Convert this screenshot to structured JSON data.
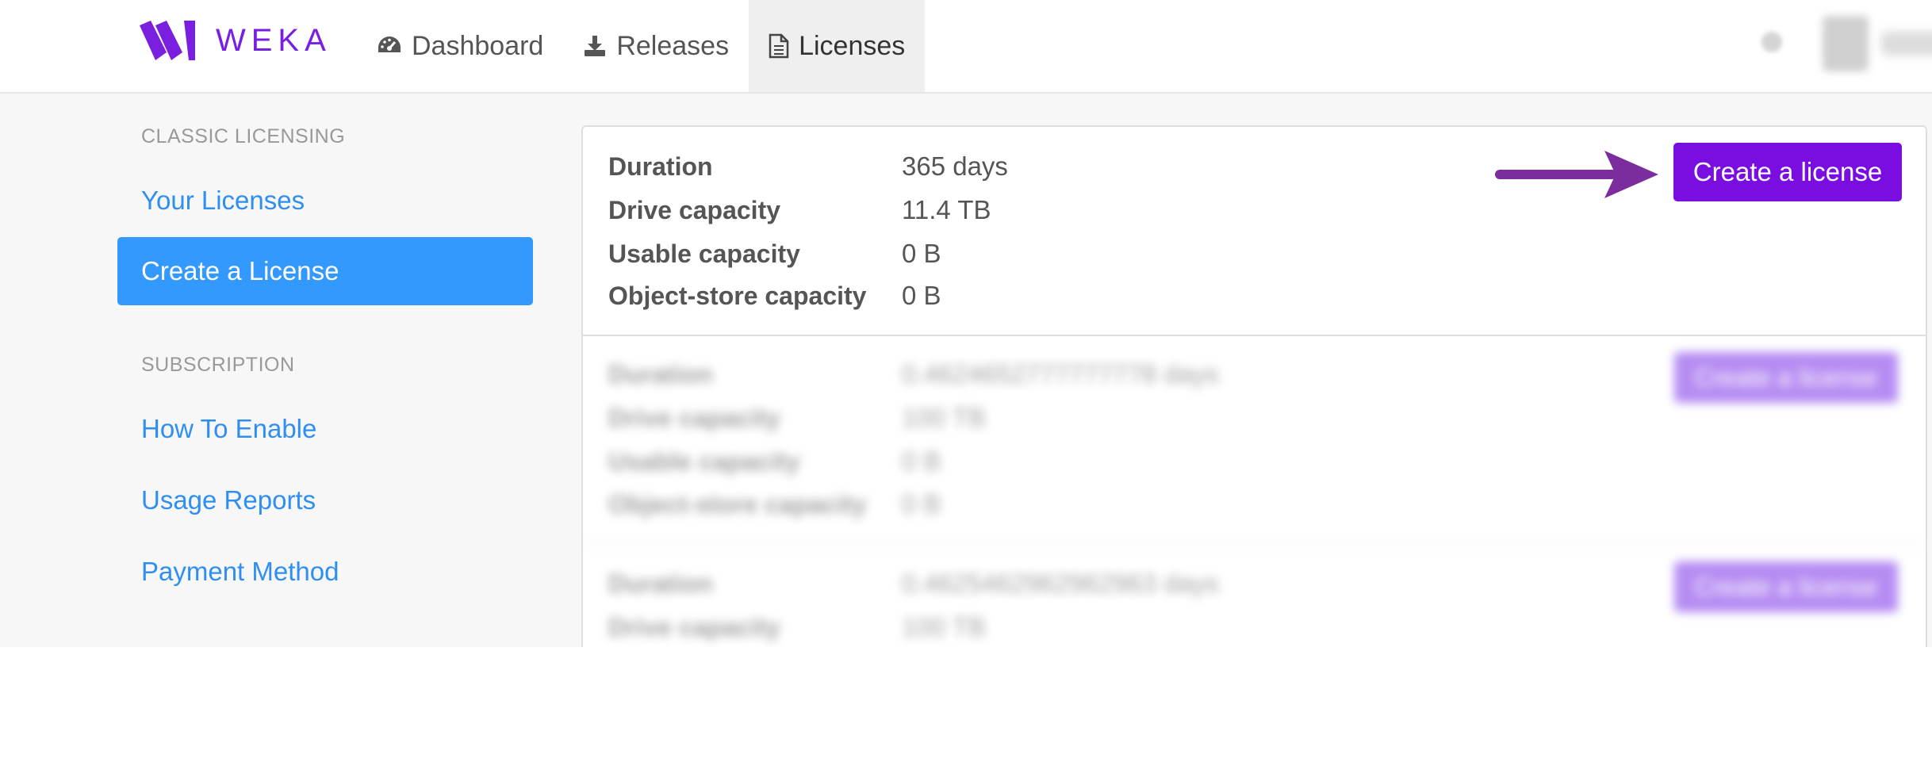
{
  "brand": {
    "name": "WEKA",
    "color": "#7a1fe0"
  },
  "nav": {
    "items": [
      {
        "label": "Dashboard",
        "icon": "dashboard-gauge-icon"
      },
      {
        "label": "Releases",
        "icon": "download-icon"
      },
      {
        "label": "Licenses",
        "icon": "document-icon",
        "active": true
      }
    ]
  },
  "sidebar": {
    "sections": [
      {
        "heading": "CLASSIC LICENSING",
        "items": [
          "Your Licenses",
          "Create a License"
        ]
      },
      {
        "heading": "SUBSCRIPTION",
        "items": [
          "How To Enable",
          "Usage Reports",
          "Payment Method"
        ]
      }
    ],
    "active_item": "Create a License"
  },
  "licenses": [
    {
      "fields": [
        {
          "label": "Duration",
          "value": "365 days"
        },
        {
          "label": "Drive capacity",
          "value": "11.4 TB"
        },
        {
          "label": "Usable capacity",
          "value": "0 B"
        },
        {
          "label": "Object-store capacity",
          "value": "0 B"
        }
      ],
      "button": "Create a license"
    },
    {
      "fields": [
        {
          "label": "Duration",
          "value": "0.4624652777777778 days"
        },
        {
          "label": "Drive capacity",
          "value": "100 TB"
        },
        {
          "label": "Usable capacity",
          "value": "0 B"
        },
        {
          "label": "Object-store capacity",
          "value": "0 B"
        }
      ],
      "button": "Create a license"
    },
    {
      "fields": [
        {
          "label": "Duration",
          "value": "0.4625462962962963 days"
        },
        {
          "label": "Drive capacity",
          "value": "100 TB"
        }
      ],
      "button": "Create a license"
    }
  ],
  "colors": {
    "accent": "#7a0ee0",
    "sidebar_active": "#3399ff",
    "link": "#2f8ff0",
    "arrow": "#7b2d9e"
  }
}
